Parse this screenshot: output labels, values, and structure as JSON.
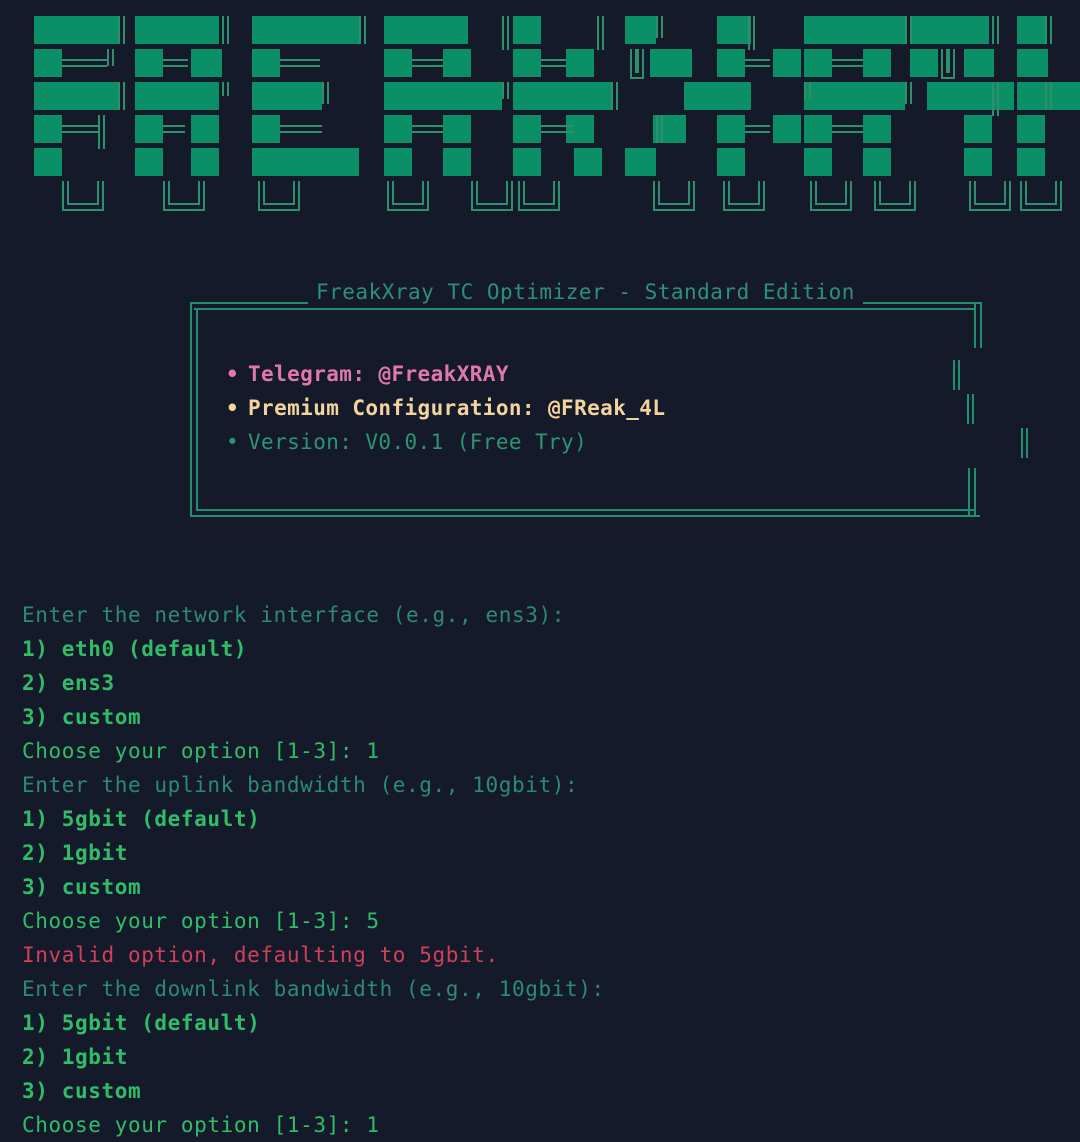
{
  "banner": {
    "text": "FREAK XRAY",
    "style": "block-ascii-art",
    "fill_color": "#0a8f67",
    "line_color": "#2e8f6d"
  },
  "box": {
    "title": "FreakXray TC Optimizer - Standard Edition",
    "title_color": "#2e8f7a",
    "border_color": "#1f8f6d",
    "items": [
      {
        "bullet": "•",
        "text": "Telegram: @FreakXRAY",
        "color": "#e078ae"
      },
      {
        "bullet": "•",
        "text": "Premium Configuration: @FReak_4L",
        "color": "#f2d49c"
      },
      {
        "bullet": "•",
        "text": "Version: V0.0.1 (Free Try)",
        "color": "#2e9472"
      }
    ]
  },
  "terminal": {
    "background": "#151a2b",
    "lines": [
      {
        "text": "Enter the network interface (e.g., ens3):",
        "kind": "prompt"
      },
      {
        "text": "1) eth0 (default)",
        "kind": "option"
      },
      {
        "text": "2) ens3",
        "kind": "option"
      },
      {
        "text": "3) custom",
        "kind": "option"
      },
      {
        "text": "Choose your option [1-3]: 1",
        "kind": "choose"
      },
      {
        "text": "Enter the uplink bandwidth (e.g., 10gbit):",
        "kind": "prompt"
      },
      {
        "text": "1) 5gbit (default)",
        "kind": "option"
      },
      {
        "text": "2) 1gbit",
        "kind": "option"
      },
      {
        "text": "3) custom",
        "kind": "option"
      },
      {
        "text": "Choose your option [1-3]: 5",
        "kind": "choose"
      },
      {
        "text": "Invalid option, defaulting to 5gbit.",
        "kind": "error"
      },
      {
        "text": "Enter the downlink bandwidth (e.g., 10gbit):",
        "kind": "prompt"
      },
      {
        "text": "1) 5gbit (default)",
        "kind": "option"
      },
      {
        "text": "2) 1gbit",
        "kind": "option"
      },
      {
        "text": "3) custom",
        "kind": "option"
      },
      {
        "text": "Choose your option [1-3]: 1",
        "kind": "choose"
      }
    ]
  }
}
